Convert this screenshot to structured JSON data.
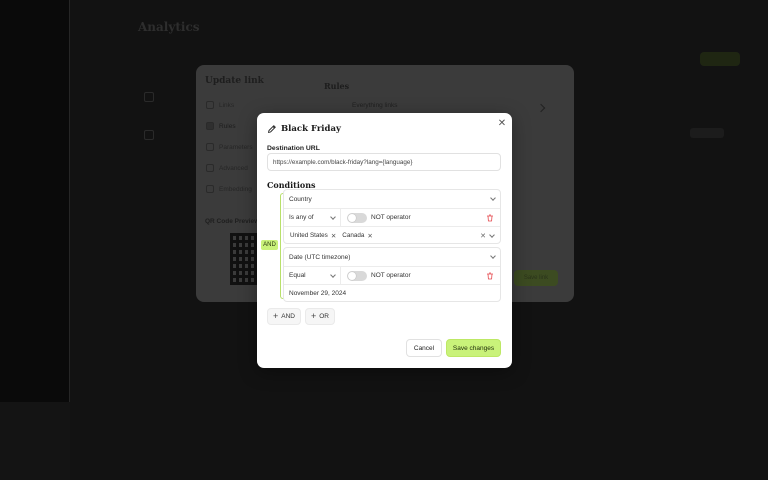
{
  "background": {
    "title": "Analytics",
    "modal_title": "Update link",
    "nav": [
      "Links",
      "Rules",
      "Parameters",
      "Advanced",
      "Embedding"
    ],
    "qr_label": "QR Code Preview",
    "rules_heading": "Rules",
    "rule_row": "Everything links",
    "save_label": "Save link"
  },
  "modal": {
    "title": "Black Friday",
    "destination_label": "Destination URL",
    "destination_value": "https://example.com/black-friday?lang={language}",
    "conditions_label": "Conditions",
    "join_operator": "AND",
    "conditions": [
      {
        "field": "Country",
        "operator": "Is any of",
        "not_label": "NOT operator",
        "values": [
          "United States",
          "Canada"
        ]
      },
      {
        "field": "Date (UTC timezone)",
        "operator": "Equal",
        "not_label": "NOT operator",
        "value": "November 29, 2024"
      }
    ],
    "add_and": "AND",
    "add_or": "OR",
    "cancel": "Cancel",
    "save": "Save changes"
  },
  "colors": {
    "accent": "#c9f27a",
    "delete": "#e5484d"
  }
}
